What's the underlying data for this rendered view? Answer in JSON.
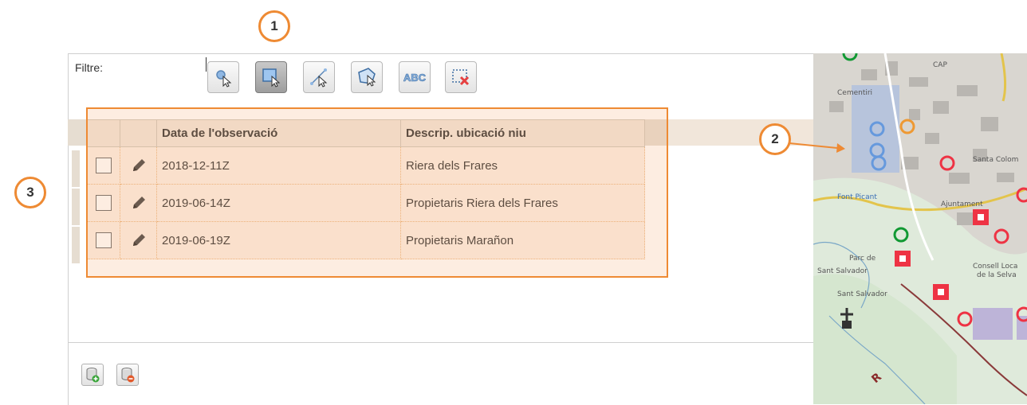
{
  "filter": {
    "label": "Filtre:",
    "tools": [
      {
        "name": "select-point-tool",
        "icon": "point-select-icon",
        "active": false
      },
      {
        "name": "select-rectangle-tool",
        "icon": "rectangle-select-icon",
        "active": true
      },
      {
        "name": "select-line-tool",
        "icon": "line-select-icon",
        "active": false
      },
      {
        "name": "select-polygon-tool",
        "icon": "polygon-select-icon",
        "active": false
      },
      {
        "name": "select-text-tool",
        "icon": "text-abc-icon",
        "label": "ABC",
        "active": false
      },
      {
        "name": "clear-selection-tool",
        "icon": "clear-selection-icon",
        "active": false
      }
    ]
  },
  "table": {
    "columns": [
      "Data de l'observació",
      "Descrip. ubicació niu"
    ],
    "rows": [
      {
        "date": "2018-12-11Z",
        "description": "Riera dels Frares"
      },
      {
        "date": "2019-06-14Z",
        "description": "Propietaris Riera dels Frares"
      },
      {
        "date": "2019-06-19Z",
        "description": "Propietaris Marañon"
      }
    ]
  },
  "footer": {
    "buttons": [
      {
        "name": "add-record-button",
        "icon": "database-add-icon"
      },
      {
        "name": "remove-record-button",
        "icon": "database-remove-icon"
      }
    ]
  },
  "annotations": {
    "badge_1": "1",
    "badge_2": "2",
    "badge_3": "3",
    "color": "#ee8a33"
  },
  "map": {
    "labels": [
      "Sant Salvador",
      "Font Picant",
      "Ajuntament",
      "Santa Colom",
      "Parc de",
      "Consell Loca",
      "de la Selva",
      "CAP",
      "Cementiri"
    ],
    "marker_colors": {
      "red": "#ee3344",
      "green": "#119933",
      "blue": "#6699dd",
      "orange": "#ee9933"
    }
  }
}
